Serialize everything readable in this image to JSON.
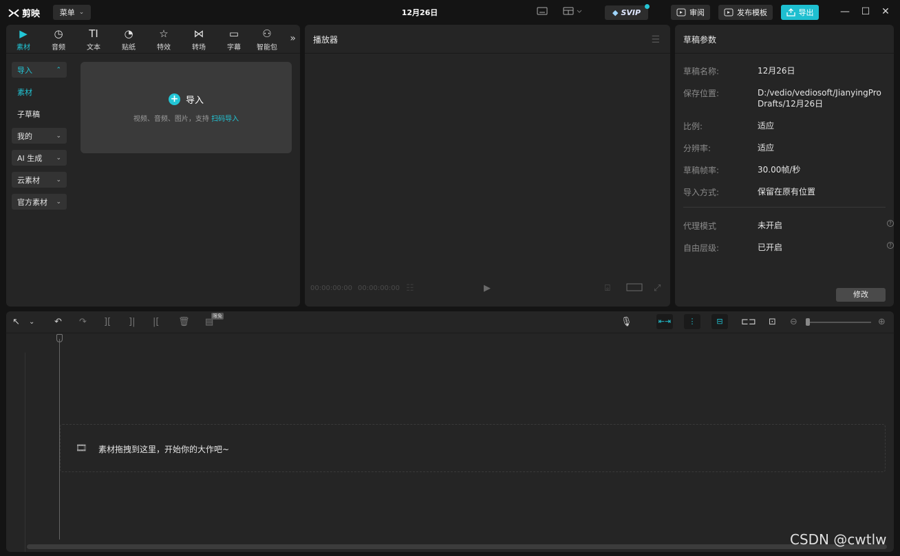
{
  "titlebar": {
    "app_name": "剪映",
    "menu_label": "菜单",
    "project_title": "12月26日",
    "svip_label": "SVIP",
    "review_label": "审阅",
    "publish_template_label": "发布模板",
    "export_label": "导出"
  },
  "left_panel": {
    "tabs": [
      {
        "label": "素材",
        "icon": "media-icon"
      },
      {
        "label": "音频",
        "icon": "audio-icon"
      },
      {
        "label": "文本",
        "icon": "text-icon"
      },
      {
        "label": "贴纸",
        "icon": "sticker-icon"
      },
      {
        "label": "特效",
        "icon": "effects-icon"
      },
      {
        "label": "转场",
        "icon": "transition-icon"
      },
      {
        "label": "字幕",
        "icon": "subtitle-icon"
      },
      {
        "label": "智能包",
        "icon": "smart-pack-icon"
      }
    ],
    "sidebar": [
      {
        "label": "导入"
      },
      {
        "label": "素材"
      },
      {
        "label": "子草稿"
      },
      {
        "label": "我的"
      },
      {
        "label": "AI 生成"
      },
      {
        "label": "云素材"
      },
      {
        "label": "官方素材"
      }
    ],
    "import_box": {
      "title": "导入",
      "subtitle": "视频、音频、图片，支持",
      "link": "扫码导入"
    }
  },
  "player": {
    "title": "播放器",
    "time_current": "00:00:00:00",
    "time_total": "00:00:00:00"
  },
  "draft_params": {
    "title": "草稿参数",
    "rows": [
      {
        "key": "草稿名称:",
        "value": "12月26日"
      },
      {
        "key": "保存位置:",
        "value": "D:/vedio/vediosoft/JianyingPro Drafts/12月26日"
      },
      {
        "key": "比例:",
        "value": "适应"
      },
      {
        "key": "分辨率:",
        "value": "适应"
      },
      {
        "key": "草稿帧率:",
        "value": "30.00帧/秒"
      },
      {
        "key": "导入方式:",
        "value": "保留在原有位置"
      },
      {
        "key": "代理模式",
        "value": "未开启"
      },
      {
        "key": "自由层级:",
        "value": "已开启"
      }
    ],
    "modify_label": "修改"
  },
  "timeline": {
    "free_badge": "限免",
    "drop_hint": "素材拖拽到这里，开始你的大作吧~"
  },
  "watermark": "CSDN @cwtlw",
  "colors": {
    "accent": "#22c6d6",
    "panel_bg": "#252525",
    "app_bg": "#141414"
  }
}
